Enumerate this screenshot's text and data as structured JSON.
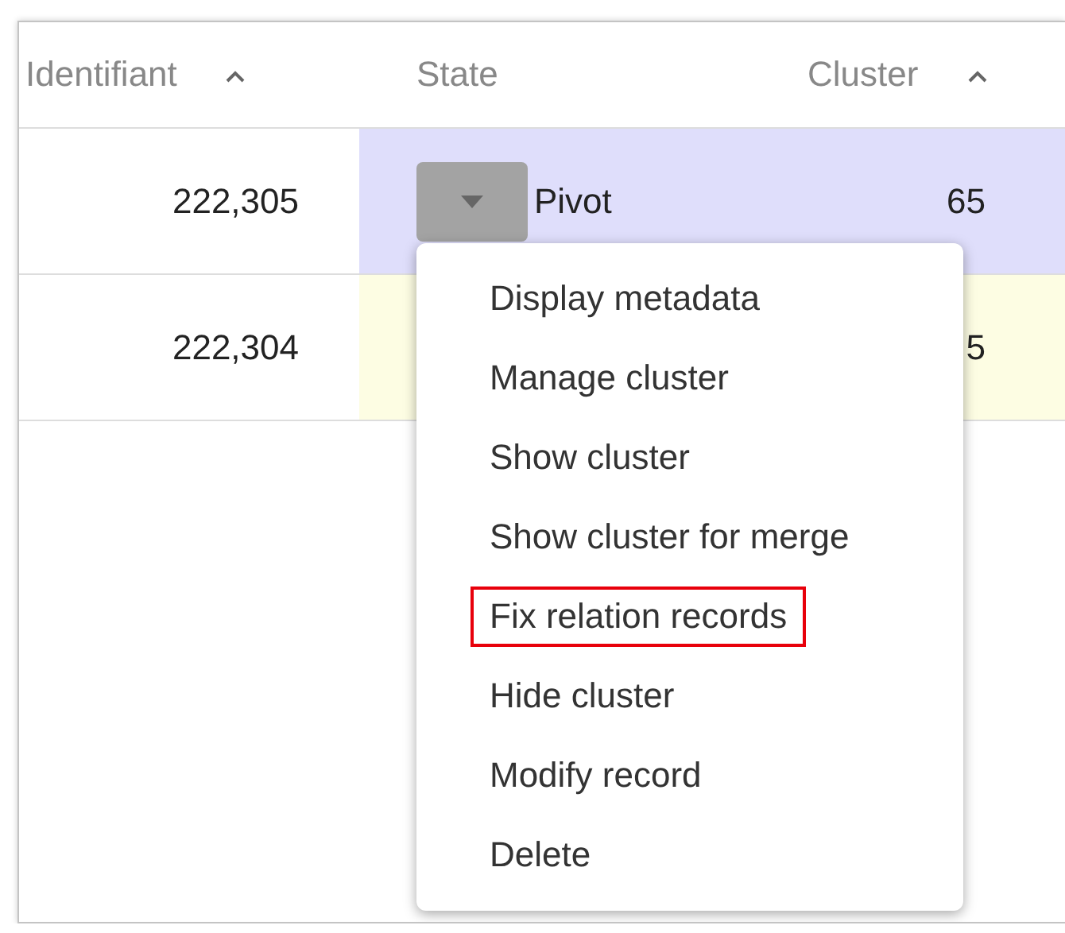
{
  "table": {
    "columns": [
      {
        "label": "Identifiant",
        "sorted": true
      },
      {
        "label": "State",
        "sorted": false
      },
      {
        "label": "Cluster",
        "sorted": true
      }
    ],
    "rows": [
      {
        "identifiant": "222,305",
        "state": "Pivot",
        "cluster": "65",
        "selected": true
      },
      {
        "identifiant": "222,304",
        "cluster": "5",
        "selected": false
      }
    ]
  },
  "context_menu": {
    "items": [
      {
        "label": "Display metadata",
        "highlighted": false
      },
      {
        "label": "Manage cluster",
        "highlighted": false
      },
      {
        "label": "Show cluster",
        "highlighted": false
      },
      {
        "label": "Show cluster for merge",
        "highlighted": false
      },
      {
        "label": "Fix relation records",
        "highlighted": true
      },
      {
        "label": "Hide cluster",
        "highlighted": false
      },
      {
        "label": "Modify record",
        "highlighted": false
      },
      {
        "label": "Delete",
        "highlighted": false
      }
    ]
  }
}
